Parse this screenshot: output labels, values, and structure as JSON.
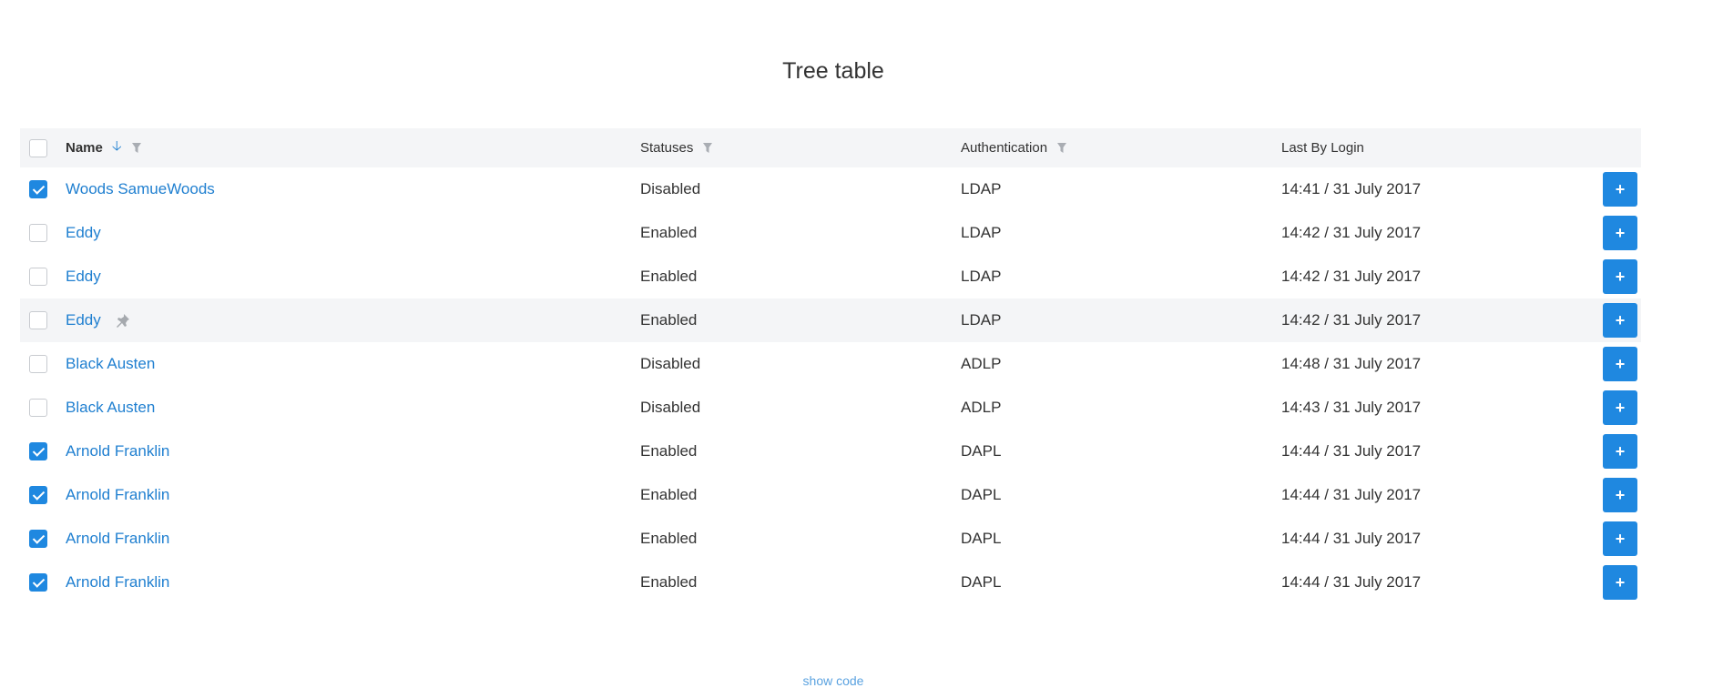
{
  "page": {
    "title": "Tree table",
    "footer_link": "show code"
  },
  "colors": {
    "accent": "#1f88e0",
    "link": "#1f7fd0",
    "header_bg": "#f4f5f7",
    "hover_bg": "#f4f5f7"
  },
  "table": {
    "headers": {
      "name": "Name",
      "status": "Statuses",
      "auth": "Authentication",
      "login": "Last By Login"
    },
    "header_icons": {
      "sort": "arrow-down-icon",
      "filter": "filter-icon"
    },
    "add_label": "+",
    "rows": [
      {
        "checked": true,
        "name": "Woods SamueWoods",
        "status": "Disabled",
        "auth": "LDAP",
        "login": "14:41 / 31 July 2017"
      },
      {
        "checked": false,
        "name": "Eddy",
        "status": "Enabled",
        "auth": "LDAP",
        "login": "14:42 / 31 July 2017"
      },
      {
        "checked": false,
        "name": "Eddy",
        "status": "Enabled",
        "auth": "LDAP",
        "login": "14:42 / 31 July 2017"
      },
      {
        "checked": false,
        "name": "Eddy",
        "status": "Enabled",
        "auth": "LDAP",
        "login": "14:42 / 31 July 2017",
        "hover": true,
        "icon": "pin-icon"
      },
      {
        "checked": false,
        "name": "Black Austen",
        "status": "Disabled",
        "auth": "ADLP",
        "login": "14:48 / 31 July 2017"
      },
      {
        "checked": false,
        "name": "Black Austen",
        "status": "Disabled",
        "auth": "ADLP",
        "login": "14:43 / 31 July 2017"
      },
      {
        "checked": true,
        "name": "Arnold Franklin",
        "status": "Enabled",
        "auth": "DAPL",
        "login": "14:44 / 31 July 2017"
      },
      {
        "checked": true,
        "name": "Arnold Franklin",
        "status": "Enabled",
        "auth": "DAPL",
        "login": "14:44 / 31 July 2017"
      },
      {
        "checked": true,
        "name": "Arnold Franklin",
        "status": "Enabled",
        "auth": "DAPL",
        "login": "14:44 / 31 July 2017"
      },
      {
        "checked": true,
        "name": "Arnold Franklin",
        "status": "Enabled",
        "auth": "DAPL",
        "login": "14:44 / 31 July 2017"
      }
    ]
  }
}
